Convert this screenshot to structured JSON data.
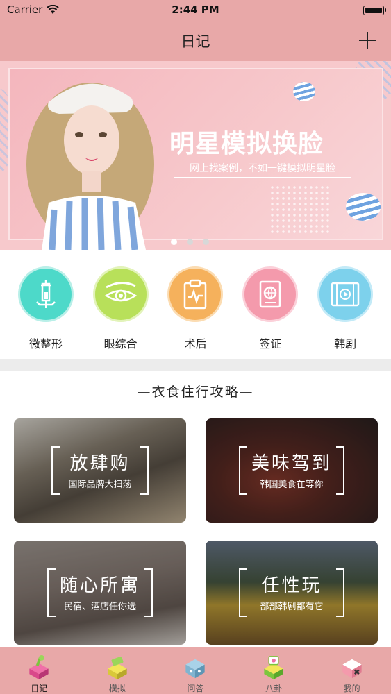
{
  "status_bar": {
    "carrier": "Carrier",
    "time": "2:44 PM"
  },
  "nav": {
    "title": "日记"
  },
  "banner": {
    "headline": "明星模拟换脸",
    "subtitle": "网上找案例，不如一键模拟明星脸",
    "active_page": 1,
    "page_count": 3
  },
  "categories": [
    {
      "label": "微整形",
      "icon": "syringe-icon",
      "color": "#4dd9c9"
    },
    {
      "label": "眼综合",
      "icon": "eye-icon",
      "color": "#b8e05a"
    },
    {
      "label": "术后",
      "icon": "clipboard-icon",
      "color": "#f5b15c"
    },
    {
      "label": "签证",
      "icon": "passport-icon",
      "color": "#f49aac"
    },
    {
      "label": "韩剧",
      "icon": "film-icon",
      "color": "#7dd1ec"
    }
  ],
  "section": {
    "title": "—衣食住行攻略—"
  },
  "cards": [
    {
      "title": "放肆购",
      "subtitle": "国际品牌大扫荡"
    },
    {
      "title": "美味驾到",
      "subtitle": "韩国美食在等你"
    },
    {
      "title": "随心所寓",
      "subtitle": "民宿、酒店任你选"
    },
    {
      "title": "任性玩",
      "subtitle": "部部韩剧都有它"
    }
  ],
  "tabs": [
    {
      "label": "日记",
      "icon": "diary-icon",
      "active": true
    },
    {
      "label": "模拟",
      "icon": "simulate-icon",
      "active": false
    },
    {
      "label": "问答",
      "icon": "qa-icon",
      "active": false
    },
    {
      "label": "八卦",
      "icon": "gossip-icon",
      "active": false
    },
    {
      "label": "我的",
      "icon": "profile-icon",
      "active": false
    }
  ]
}
